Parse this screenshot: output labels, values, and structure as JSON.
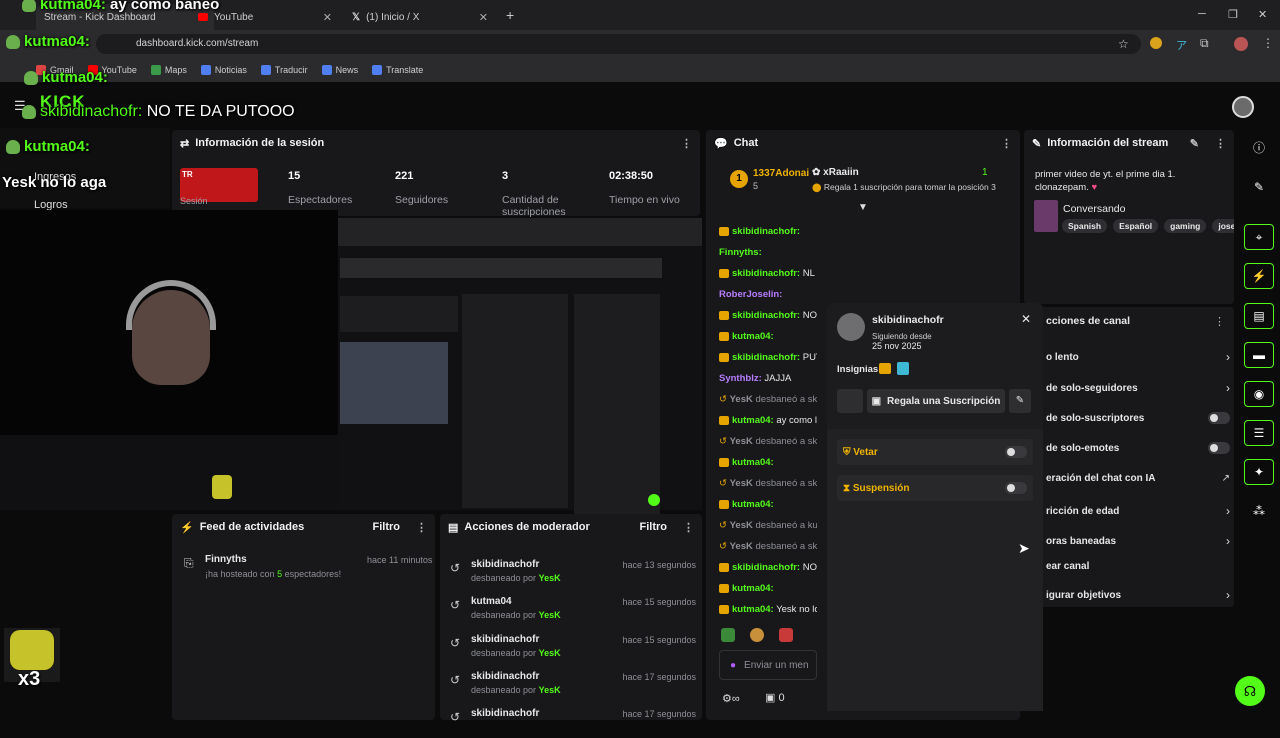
{
  "browser": {
    "tabs": [
      {
        "label": "Stream - Kick Dashboard"
      },
      {
        "label": "YouTube"
      },
      {
        "label": "(1) Inicio / X"
      }
    ],
    "url": "dashboard.kick.com/stream",
    "bookmarks": [
      "Gmail",
      "YouTube",
      "Maps",
      "Noticias",
      "Traducir",
      "News",
      "Translate"
    ]
  },
  "overlay": {
    "messages": [
      {
        "user": "kutma04:",
        "text": "ay como baneo"
      },
      {
        "user": "kutma04:",
        "text": ""
      },
      {
        "user": "kutma04:",
        "text": ""
      },
      {
        "user": "skibidinachofr:",
        "text": "NO TE DA PUTOOO"
      },
      {
        "user": "kutma04:",
        "text": ""
      },
      {
        "user": "",
        "text": "Yesk no lo aga"
      }
    ],
    "sidebar_fragments": [
      "Ingresos",
      "Logros"
    ],
    "multiplier": "x3",
    "kick_logo": "KICK"
  },
  "session": {
    "title": "Información de la sesión",
    "live_tag": "TR",
    "session_label": "Sesión",
    "stats": [
      {
        "value": "15",
        "label": "Espectadores"
      },
      {
        "value": "221",
        "label": "Seguidores"
      },
      {
        "value": "3",
        "label": "Cantidad de suscripciones"
      },
      {
        "value": "02:38:50",
        "label": "Tiempo en vivo"
      }
    ]
  },
  "activity": {
    "title": "Feed de actividades",
    "filter": "Filtro",
    "items": [
      {
        "user": "Finnyths",
        "time": "hace 11 minutos",
        "pre": "¡ha hosteado con ",
        "count": "5",
        "post": " espectadores!"
      }
    ]
  },
  "mod_actions": {
    "title": "Acciones de moderador",
    "filter": "Filtro",
    "items": [
      {
        "user": "skibidinachofr",
        "by": "YesK",
        "time": "hace 13 segundos"
      },
      {
        "user": "kutma04",
        "by": "YesK",
        "time": "hace 15 segundos"
      },
      {
        "user": "skibidinachofr",
        "by": "YesK",
        "time": "hace 15 segundos"
      },
      {
        "user": "skibidinachofr",
        "by": "YesK",
        "time": "hace 17 segundos"
      },
      {
        "user": "skibidinachofr",
        "by": "",
        "time": "hace 17 segundos"
      }
    ],
    "action_prefix": "desbaneado por "
  },
  "chat": {
    "title": "Chat",
    "leader": {
      "name": "1337Adonai",
      "count": "5",
      "rank": "1"
    },
    "gift_user": "xRaaiin",
    "gift_rank": "1",
    "gift_text": "Regala 1 suscripción para tomar la posición 3",
    "lines": [
      {
        "user": "skibidinachofr:",
        "text": "",
        "cls": "green",
        "badge": true
      },
      {
        "user": "Finnyths:",
        "text": "",
        "cls": "green",
        "badge": false
      },
      {
        "user": "skibidinachofr:",
        "text": "NL TE DA",
        "cls": "green",
        "badge": true
      },
      {
        "user": "RoberJoselin:",
        "text": "",
        "cls": "purple",
        "badge": false
      },
      {
        "user": "skibidinachofr:",
        "text": "NO",
        "cls": "green",
        "badge": true
      },
      {
        "user": "kutma04:",
        "text": "",
        "cls": "green",
        "badge": true
      },
      {
        "user": "skibidinachofr:",
        "text": "PUT",
        "cls": "green",
        "badge": true
      },
      {
        "user": "Synthblz:",
        "text": "JAJJA",
        "cls": "purple",
        "badge": false
      },
      {
        "user": "YesK",
        "text": "desbaneó a skib",
        "cls": "sys",
        "badge": false
      },
      {
        "user": "kutma04:",
        "text": "ay como l",
        "cls": "green",
        "badge": true
      },
      {
        "user": "YesK",
        "text": "desbaneó a skib",
        "cls": "sys",
        "badge": false
      },
      {
        "user": "kutma04:",
        "text": "",
        "cls": "green",
        "badge": true
      },
      {
        "user": "YesK",
        "text": "desbaneó a skib",
        "cls": "sys",
        "badge": false
      },
      {
        "user": "kutma04:",
        "text": "",
        "cls": "green",
        "badge": true
      },
      {
        "user": "YesK",
        "text": "desbaneó a kutr",
        "cls": "sys",
        "badge": false
      },
      {
        "user": "YesK",
        "text": "desbaneó a skib",
        "cls": "sys",
        "badge": false
      },
      {
        "user": "skibidinachofr:",
        "text": "NO",
        "cls": "green",
        "badge": true
      },
      {
        "user": "kutma04:",
        "text": "",
        "cls": "green",
        "badge": true
      },
      {
        "user": "kutma04:",
        "text": "Yesk no lo",
        "cls": "green",
        "badge": true
      }
    ],
    "input_placeholder": "Enviar un men",
    "points": "0"
  },
  "stream_info": {
    "title": "Información del stream",
    "description": "primer video de yt. el prime dia 1. clonazepam. ",
    "category": "Conversando",
    "tags": [
      "Spanish",
      "Español",
      "gaming",
      "jose"
    ]
  },
  "channel_actions": {
    "title": "cciones de canal",
    "rows": [
      {
        "label": "o lento",
        "ctl": "arrow"
      },
      {
        "label": "de solo-seguidores",
        "ctl": "arrow"
      },
      {
        "label": "de solo-suscriptores",
        "ctl": "toggle"
      },
      {
        "label": "de solo-emotes",
        "ctl": "toggle"
      },
      {
        "label": "eración del chat con IA",
        "ctl": "ext"
      },
      {
        "label": "ricción de edad",
        "ctl": "arrow"
      },
      {
        "label": "oras baneadas",
        "ctl": "arrow"
      },
      {
        "label": "ear canal",
        "ctl": "none"
      },
      {
        "label": "igurar objetivos",
        "ctl": "arrow"
      }
    ]
  },
  "user_popup": {
    "username": "skibidinachofr",
    "following_label": "Siguiendo desde",
    "following_date": "25 nov 2025",
    "badges_label": "Insignias",
    "gift_button": "Regala una Suscripción",
    "toggles": [
      {
        "label": "Vetar"
      },
      {
        "label": "Suspensión"
      }
    ]
  }
}
